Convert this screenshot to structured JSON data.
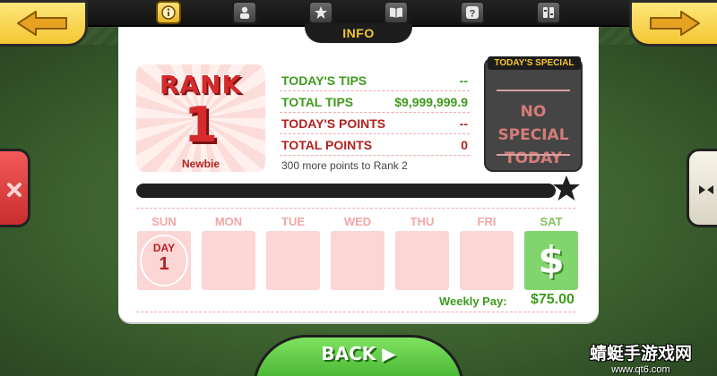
{
  "header": {
    "title": "INFO",
    "tabs": [
      {
        "name": "info",
        "icon": "info-icon",
        "active": true
      },
      {
        "name": "profile",
        "icon": "person-icon",
        "active": false
      },
      {
        "name": "rank",
        "icon": "star-icon",
        "active": false
      },
      {
        "name": "book",
        "icon": "book-icon",
        "active": false
      },
      {
        "name": "help",
        "icon": "question-icon",
        "active": false
      },
      {
        "name": "settings",
        "icon": "sliders-icon",
        "active": false
      }
    ]
  },
  "rank": {
    "label": "RANK",
    "number": "1",
    "title": "Newbie"
  },
  "stats": [
    {
      "label": "TODAY'S TIPS",
      "value": "--",
      "color": "#3f9a1d"
    },
    {
      "label": "TOTAL TIPS",
      "value": "$9,999,999.9",
      "color": "#3f9a1d"
    },
    {
      "label": "TODAY'S POINTS",
      "value": "--",
      "color": "#b32020"
    },
    {
      "label": "TOTAL POINTS",
      "value": "0",
      "color": "#b32020"
    }
  ],
  "next_rank_text": "300 more points to Rank 2",
  "rank_progress": 0,
  "special": {
    "tag": "TODAY'S SPECIAL",
    "line1": "NO SPECIAL",
    "line2": "TODAY"
  },
  "week": {
    "days": [
      "SUN",
      "MON",
      "TUE",
      "WED",
      "THU",
      "FRI",
      "SAT"
    ],
    "current_day_label": "DAY",
    "current_day_number": "1",
    "payday_icon": "$",
    "weekly_pay_label": "Weekly Pay:",
    "weekly_pay_value": "$75.00"
  },
  "back_label": "BACK ▶",
  "watermark": {
    "main": "蜻蜓手游戏网",
    "sub": "www.qt6.com"
  },
  "colors": {
    "accent_yellow": "#f4c633",
    "tip_green": "#3f9a1d",
    "point_red": "#b32020"
  }
}
